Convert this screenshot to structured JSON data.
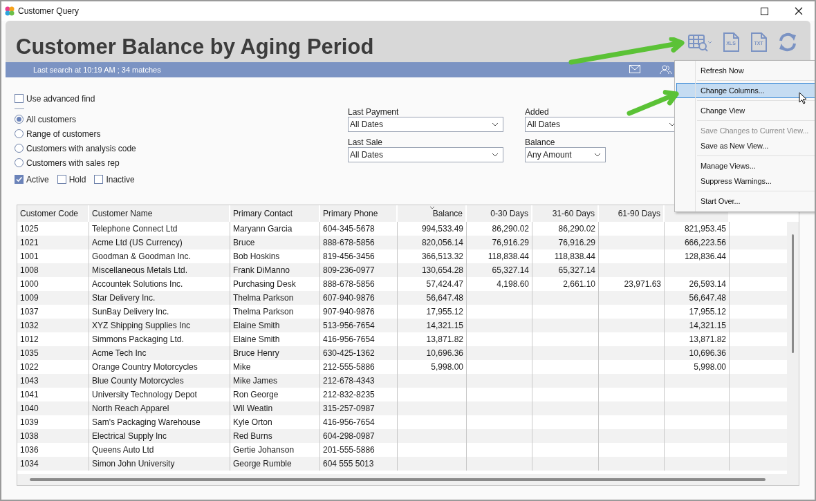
{
  "window": {
    "title": "Customer Query"
  },
  "header": {
    "title": "Customer Balance by Aging Period",
    "toolbar": [
      {
        "kind": "columns"
      },
      {
        "kind": "file",
        "label": "XLS"
      },
      {
        "kind": "file",
        "label": "TXT"
      },
      {
        "kind": "refresh"
      }
    ]
  },
  "info_bar": {
    "text": "Last search at 10:19 AM ; 34 matches"
  },
  "filters": {
    "advanced_find": {
      "label": "Use advanced find",
      "checked": false
    },
    "scope": [
      {
        "label": "All customers",
        "selected": true
      },
      {
        "label": "Range of customers",
        "selected": false
      },
      {
        "label": "Customers with analysis code",
        "selected": false
      },
      {
        "label": "Customers with sales rep",
        "selected": false
      }
    ],
    "status": [
      {
        "label": "Active",
        "checked": true
      },
      {
        "label": "Hold",
        "checked": false
      },
      {
        "label": "Inactive",
        "checked": false
      }
    ],
    "dropdowns": [
      {
        "label": "Last Payment",
        "value": "All Dates"
      },
      {
        "label": "Last Sale",
        "value": "All Dates"
      },
      {
        "label": "Added",
        "value": "All Dates"
      },
      {
        "label": "Balance",
        "value": "Any Amount"
      }
    ]
  },
  "table": {
    "columns": [
      {
        "label": "Customer Code",
        "sorted": false
      },
      {
        "label": "Customer Name",
        "sorted": false
      },
      {
        "label": "Primary Contact",
        "sorted": false
      },
      {
        "label": "Primary Phone",
        "sorted": false
      },
      {
        "label": "Balance",
        "sorted": true
      },
      {
        "label": "0-30 Days",
        "sorted": false
      },
      {
        "label": "31-60 Days",
        "sorted": false
      },
      {
        "label": "61-90 Days",
        "sorted": false
      },
      {}
    ],
    "rows": [
      [
        "1025",
        "Telephone Connect Ltd",
        "Maryann Garcia",
        "604-345-5678",
        "994,533.49",
        "86,290.02",
        "86,290.02",
        null,
        "821,953.45"
      ],
      [
        "1021",
        "Acme Ltd (US Currency)",
        "Bruce",
        "888-678-5856",
        "820,056.14",
        "76,916.29",
        "76,916.29",
        null,
        "666,223.56"
      ],
      [
        "1001",
        "Goodman & Goodman Inc.",
        "Bob Hoskins",
        "819-456-3456",
        "366,513.32",
        "118,838.44",
        "118,838.44",
        null,
        "128,836.44"
      ],
      [
        "1008",
        "Miscellaneous Metals Ltd.",
        "Frank DiManno",
        "809-236-0977",
        "130,654.28",
        "65,327.14",
        "65,327.14",
        null,
        null
      ],
      [
        "1000",
        "Accountek Solutions Inc.",
        "Purchasing Desk",
        "888-678-5856",
        "57,424.47",
        "4,198.60",
        "2,661.10",
        "23,971.63",
        "26,593.14"
      ],
      [
        "1009",
        "Star Delivery Inc.",
        "Thelma Parkson",
        "607-940-9876",
        "56,647.48",
        null,
        null,
        null,
        "56,647.48"
      ],
      [
        "1037",
        "SunBay Delivery Inc.",
        "Thelma Parkson",
        "907-940-9876",
        "17,955.12",
        null,
        null,
        null,
        "17,955.12"
      ],
      [
        "1032",
        "XYZ Shipping Supplies Inc",
        "Elaine Smith",
        "513-956-7654",
        "14,321.15",
        null,
        null,
        null,
        "14,321.15"
      ],
      [
        "1012",
        "Simmons Packaging Ltd.",
        "Elaine Smith",
        "416-956-7654",
        "13,871.82",
        null,
        null,
        null,
        "13,871.82"
      ],
      [
        "1035",
        "Acme Tech Inc",
        "Bruce Henry",
        "630-425-1362",
        "10,696.36",
        null,
        null,
        null,
        "10,696.36"
      ],
      [
        "1022",
        "Orange Country Motorcycles",
        "Mike",
        "212-555-5886",
        "5,998.00",
        null,
        null,
        null,
        "5,998.00"
      ],
      [
        "1043",
        "Blue County Motorcycles",
        "Mike James",
        "212-678-4343",
        null,
        null,
        null,
        null,
        null
      ],
      [
        "1041",
        "University Technology Depot",
        "Ron George",
        "212-832-8235",
        null,
        null,
        null,
        null,
        null
      ],
      [
        "1040",
        "North Reach Apparel",
        "Wil Weatin",
        "315-257-0987",
        null,
        null,
        null,
        null,
        null
      ],
      [
        "1039",
        "Sam's Packaging Warehouse",
        "Kyle Orton",
        "416-956-7654",
        null,
        null,
        null,
        null,
        null
      ],
      [
        "1038",
        "Electrical Supply Inc",
        "Red Burns",
        "604-298-0987",
        null,
        null,
        null,
        null,
        null
      ],
      [
        "1036",
        "Queens Auto Ltd",
        "Gertie Johanson",
        "201-555-5886",
        null,
        null,
        null,
        null,
        null
      ],
      [
        "1034",
        "Simon John University",
        "George Rumble",
        "604 555 5013",
        null,
        null,
        null,
        null,
        null
      ]
    ]
  },
  "context_menu": {
    "items": [
      {
        "kind": "item",
        "label": "Refresh Now",
        "selected": false,
        "disabled": false
      },
      {
        "kind": "separator"
      },
      {
        "kind": "item",
        "label": "Change Columns...",
        "selected": true,
        "disabled": false
      },
      {
        "kind": "separator"
      },
      {
        "kind": "item",
        "label": "Change View",
        "selected": false,
        "disabled": false
      },
      {
        "kind": "separator"
      },
      {
        "kind": "item",
        "label": "Save Changes to Current View...",
        "selected": false,
        "disabled": true
      },
      {
        "kind": "item",
        "label": "Save as New View...",
        "selected": false,
        "disabled": false
      },
      {
        "kind": "separator"
      },
      {
        "kind": "item",
        "label": "Manage Views...",
        "selected": false,
        "disabled": false
      },
      {
        "kind": "item",
        "label": "Suppress Warnings...",
        "selected": false,
        "disabled": false
      },
      {
        "kind": "separator"
      },
      {
        "kind": "item",
        "label": "Start Over...",
        "selected": false,
        "disabled": false
      }
    ]
  }
}
